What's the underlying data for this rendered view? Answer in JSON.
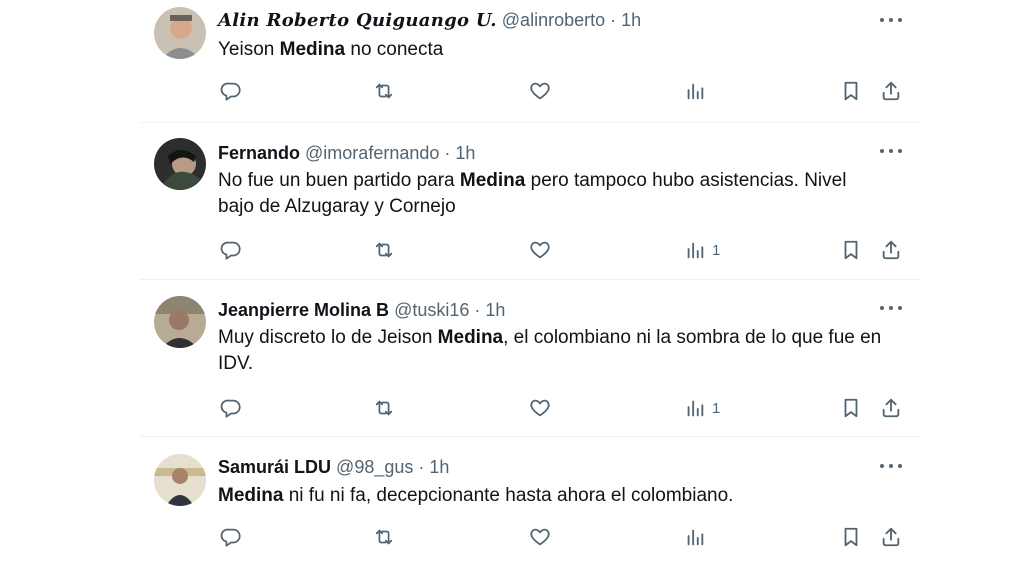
{
  "colors": {
    "text": "#0f1419",
    "secondary": "#536471",
    "divider": "#eff3f4"
  },
  "tweets": [
    {
      "name": "Alin Roberto Quiguango U.",
      "handle": "@alinroberto",
      "sep": "·",
      "time": "1h",
      "text": [
        {
          "t": "Yeison ",
          "b": false
        },
        {
          "t": "Medina",
          "b": true
        },
        {
          "t": " no conecta",
          "b": false
        }
      ],
      "views": ""
    },
    {
      "name": "Fernando",
      "handle": "@imorafernando",
      "sep": "·",
      "time": "1h",
      "text": [
        {
          "t": "No fue un buen partido para ",
          "b": false
        },
        {
          "t": "Medina",
          "b": true
        },
        {
          "t": " pero tampoco hubo asistencias. Nivel bajo de Alzugaray y Cornejo",
          "b": false
        }
      ],
      "views": "1"
    },
    {
      "name": "Jeanpierre Molina B",
      "handle": "@tuski16",
      "sep": "·",
      "time": "1h",
      "text": [
        {
          "t": "Muy discreto lo de Jeison ",
          "b": false
        },
        {
          "t": "Medina",
          "b": true
        },
        {
          "t": ", el colombiano ni la sombra de lo que fue en IDV.",
          "b": false
        }
      ],
      "views": "1"
    },
    {
      "name": "Samurái LDU",
      "handle": "@98_gus",
      "sep": "·",
      "time": "1h",
      "text": [
        {
          "t": "Medina",
          "b": true
        },
        {
          "t": " ni fu ni fa, decepcionante hasta ahora el colombiano.",
          "b": false
        }
      ],
      "views": ""
    }
  ],
  "icons": {
    "reply": "reply-icon",
    "retweet": "retweet-icon",
    "like": "heart-icon",
    "views": "views-chart-icon",
    "bookmark": "bookmark-icon",
    "share": "share-icon",
    "more": "more-dots-icon"
  }
}
